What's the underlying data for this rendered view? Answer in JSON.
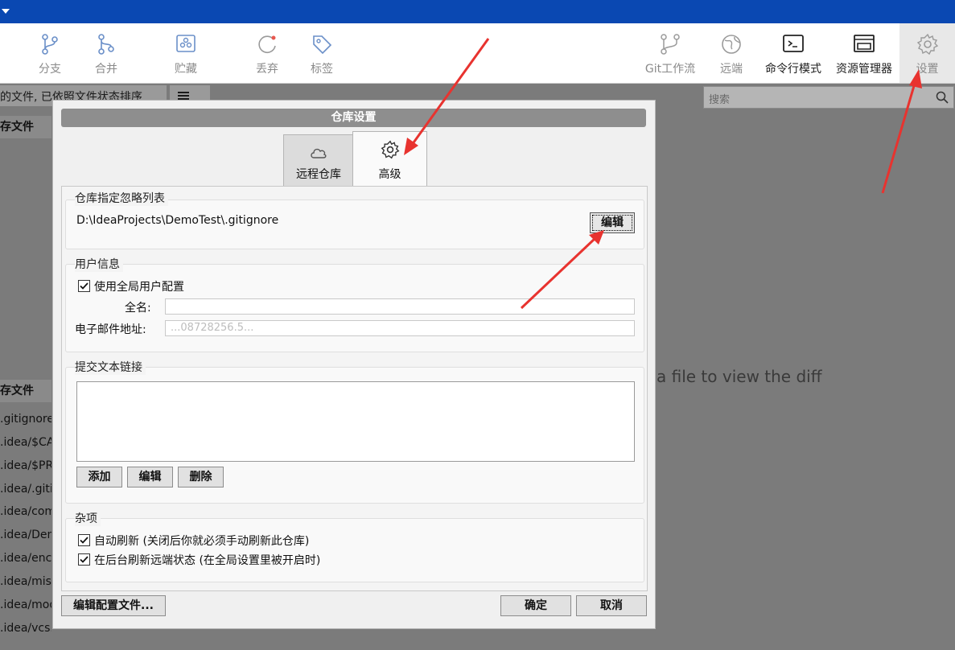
{
  "toolbar": {
    "branch": "分支",
    "merge": "合并",
    "stash": "贮藏",
    "discard": "丢弃",
    "tag": "标签",
    "gitflow": "Git工作流",
    "remote": "远端",
    "terminal": "命令行模式",
    "explorer": "资源管理器",
    "settings": "设置"
  },
  "filter": {
    "text": "的文件, 已依照文件状态排序"
  },
  "search": {
    "placeholder": "搜索"
  },
  "left_pane": {
    "header_top": "存文件",
    "header_bottom": "存文件",
    "files": [
      ".gitignore",
      ".idea/$CA",
      ".idea/$PR",
      ".idea/.giti",
      ".idea/com",
      ".idea/Dem",
      ".idea/enc",
      ".idea/misc",
      ".idea/mod",
      ".idea/vcs.xml"
    ]
  },
  "diff_hint": "a file to view the diff",
  "dialog": {
    "title": "仓库设置",
    "tabs": {
      "remote": "远程仓库",
      "advanced": "高级"
    },
    "ignore": {
      "title": "仓库指定忽略列表",
      "path": "D:\\IdeaProjects\\DemoTest\\.gitignore",
      "edit": "编辑"
    },
    "user": {
      "title": "用户信息",
      "use_global": "使用全局用户配置",
      "full_name_label": "全名:",
      "email_label": "电子邮件地址:",
      "email_value": "...08728256.5..."
    },
    "commit_links": {
      "title": "提交文本链接",
      "add": "添加",
      "edit": "编辑",
      "delete": "删除"
    },
    "misc": {
      "title": "杂项",
      "auto_refresh": "自动刷新 (关闭后你就必须手动刷新此仓库)",
      "bg_refresh": "在后台刷新远端状态 (在全局设置里被开启时)"
    },
    "footer": {
      "edit_config": "编辑配置文件...",
      "ok": "确定",
      "cancel": "取消"
    }
  },
  "colors": {
    "titlebar": "#0a48b2",
    "annotation_arrow": "#e8332f"
  }
}
